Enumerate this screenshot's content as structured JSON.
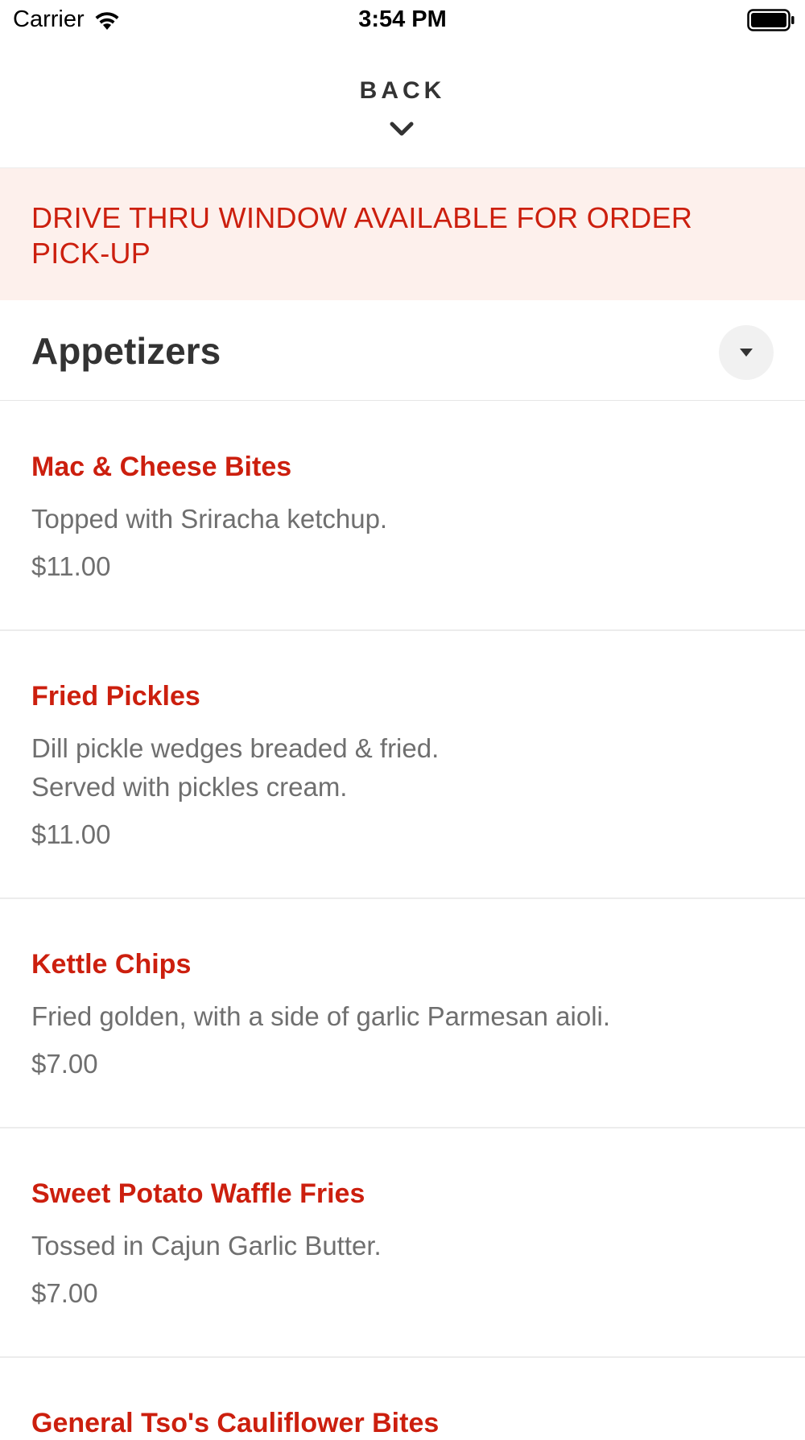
{
  "status_bar": {
    "carrier": "Carrier",
    "time": "3:54 PM"
  },
  "header": {
    "back_label": "BACK"
  },
  "banner": {
    "text": "DRIVE THRU WINDOW AVAILABLE FOR ORDER PICK-UP"
  },
  "section": {
    "title": "Appetizers"
  },
  "items": [
    {
      "name": "Mac & Cheese Bites",
      "description": "Topped with Sriracha ketchup.",
      "price": "$11.00"
    },
    {
      "name": "Fried Pickles",
      "description": "Dill pickle wedges breaded & fried.\nServed with pickles cream.",
      "price": "$11.00"
    },
    {
      "name": "Kettle Chips",
      "description": "Fried golden, with a side of garlic Parmesan aioli.",
      "price": "$7.00"
    },
    {
      "name": "Sweet Potato Waffle Fries",
      "description": "Tossed in Cajun Garlic Butter.",
      "price": "$7.00"
    },
    {
      "name": "General Tso's Cauliflower Bites",
      "description": "",
      "price": ""
    }
  ],
  "colors": {
    "accent": "#cc1f0e",
    "banner_bg": "#fdf0ec",
    "text_secondary": "#6f6f6f"
  },
  "icons": {
    "wifi": "wifi-icon",
    "battery": "battery-icon",
    "back_chevron": "chevron-down-icon",
    "section_toggle": "caret-down-icon"
  }
}
